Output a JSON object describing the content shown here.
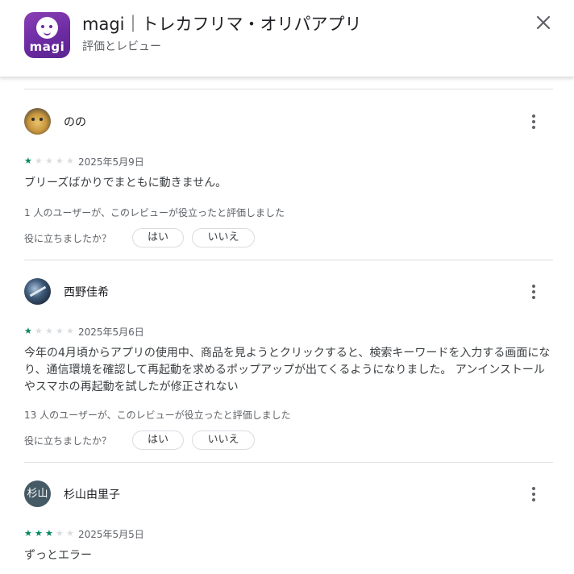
{
  "header": {
    "logo_text": "magi",
    "title": "magi｜トレカフリマ・オリパアプリ",
    "subtitle": "評価とレビュー"
  },
  "reviews": [
    {
      "author": "のの",
      "rating": 1,
      "max_rating": 5,
      "date": "2025年5月9日",
      "text": "ブリーズばかりでまともに動きません。",
      "helpful_count_text": "1 人のユーザーが、このレビューが役立ったと評価しました",
      "helpful_question": "役に立ちましたか？",
      "yes_label": "はい",
      "no_label": "いいえ"
    },
    {
      "author": "西野佳希",
      "rating": 1,
      "max_rating": 5,
      "date": "2025年5月6日",
      "text": "今年の4月頃からアプリの使用中、商品を見ようとクリックすると、検索キーワードを入力する画面になり、通信環境を確認して再起動を求めるポップアップが出てくるようになりました。 アンインストールやスマホの再起動を試したが修正されない",
      "helpful_count_text": "13 人のユーザーが、このレビューが役立ったと評価しました",
      "helpful_question": "役に立ちましたか？",
      "yes_label": "はい",
      "no_label": "いいえ"
    },
    {
      "author": "杉山由里子",
      "avatar_text": "杉山",
      "rating": 3,
      "max_rating": 5,
      "date": "2025年5月5日",
      "text": "ずっとエラー"
    }
  ],
  "colors": {
    "star_filled": "#01875f",
    "star_empty": "#dadce0",
    "app_icon_purple": "#6a2aa0"
  },
  "icons": {
    "close": "close-icon",
    "more": "more-vert-icon",
    "star": "star-icon"
  }
}
